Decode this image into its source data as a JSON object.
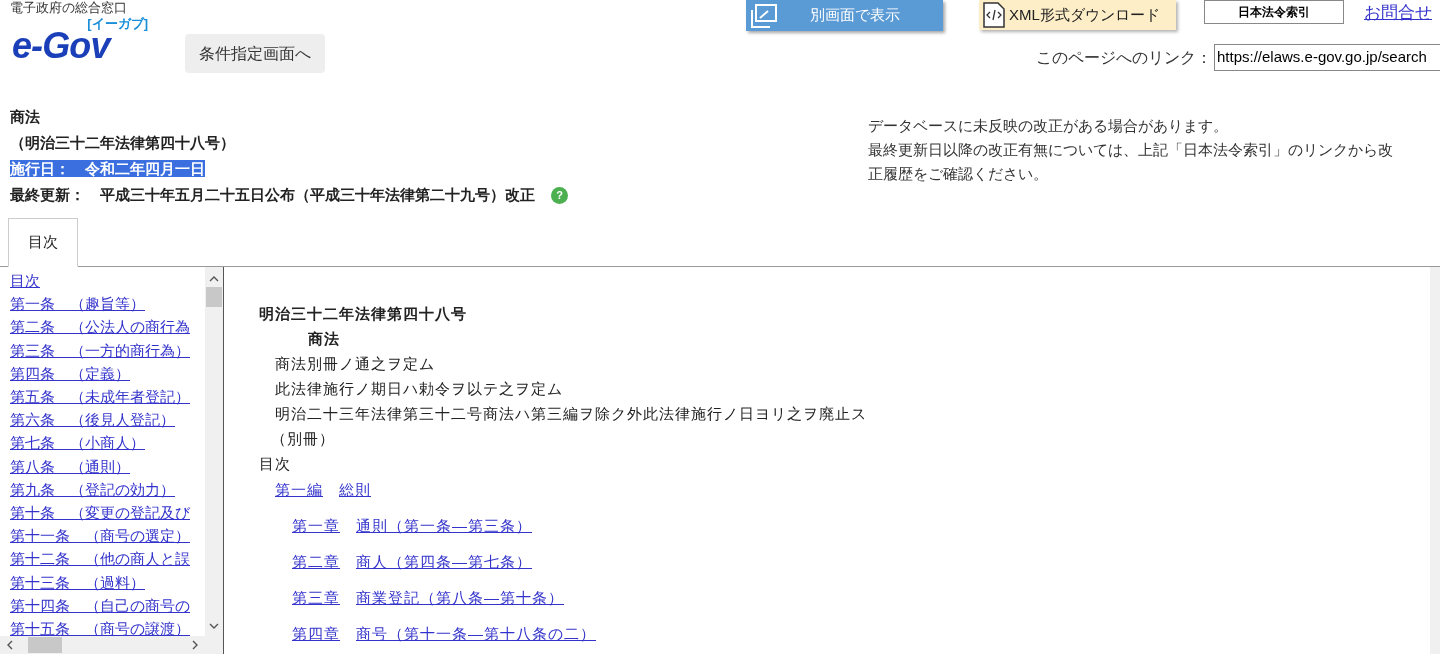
{
  "header": {
    "portal_label": "電子政府の総合窓口",
    "logo": {
      "text": "e-Gov",
      "reading": "[イーガブ]"
    },
    "search_button": "条件指定画面へ",
    "actions": [
      {
        "kind": "window",
        "label": "別画面で表示"
      },
      {
        "kind": "xml",
        "label": "XML形式ダウンロード"
      },
      {
        "kind": "index",
        "label": "日本法令索引"
      },
      {
        "kind": "link",
        "label": "お問合せ"
      }
    ],
    "page_link": {
      "label": "このページへのリンク：",
      "value": "https://elaws.e-gov.go.jp/search"
    }
  },
  "law": {
    "title": "商法",
    "number": "（明治三十二年法律第四十八号）",
    "effective": {
      "label": "施行日：",
      "value": "令和二年四月一日",
      "highlighted": true
    },
    "updated": {
      "label": "最終更新：",
      "value": "平成三十年五月二十五日公布（平成三十年法律第二十九号）改正",
      "help": "?"
    }
  },
  "notice": [
    "データベースに未反映の改正がある場合があります。",
    "最終更新日以降の改正有無については、上記「日本法令索引」のリンクから改",
    "正履歴をご確認ください。"
  ],
  "tabs": [
    {
      "label": "目次",
      "selected": true
    }
  ],
  "sidebar": {
    "items": [
      "目次",
      "第一条　（趣旨等）",
      "第二条　（公法人の商行為",
      "第三条　（一方的商行為）",
      "第四条　（定義）",
      "第五条　（未成年者登記）",
      "第六条　（後見人登記）",
      "第七条　（小商人）",
      "第八条　（通則）",
      "第九条　（登記の効力）",
      "第十条　（変更の登記及び",
      "第十一条　（商号の選定）",
      "第十二条　（他の商人と誤",
      "第十三条　（過料）",
      "第十四条　（自己の商号の",
      "第十五条　（商号の譲渡）"
    ]
  },
  "content": {
    "law_number": "明治三十二年法律第四十八号",
    "title": "商法",
    "preamble": [
      "商法別冊ノ通之ヲ定ム",
      "此法律施行ノ期日ハ勅令ヲ以テ之ヲ定ム",
      "明治二十三年法律第三十二号商法ハ第三編ヲ除ク外此法律施行ノ日ヨリ之ヲ廃止ス"
    ],
    "appendix": "（別冊）",
    "toc_heading": "目次",
    "part": {
      "number": "第一編",
      "title": "総則"
    },
    "chapters": [
      {
        "number": "第一章",
        "title": "通則（第一条―第三条）"
      },
      {
        "number": "第二章",
        "title": "商人（第四条―第七条）"
      },
      {
        "number": "第三章",
        "title": "商業登記（第八条―第十条）"
      },
      {
        "number": "第四章",
        "title": "商号（第十一条―第十八条の二）"
      }
    ]
  }
}
